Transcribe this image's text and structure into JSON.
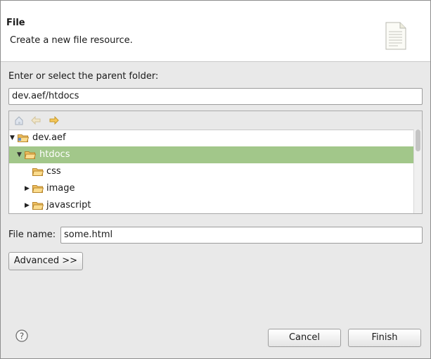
{
  "header": {
    "title": "File",
    "subtitle": "Create a new file resource."
  },
  "parent_folder": {
    "label": "Enter or select the parent folder:",
    "value": "dev.aef/htdocs"
  },
  "tree": {
    "toolbar": [
      "home-icon",
      "back-icon",
      "forward-icon"
    ],
    "items": [
      {
        "label": "dev.aef",
        "expanded": true
      },
      {
        "label": "htdocs",
        "expanded": true,
        "selected": true
      },
      {
        "label": "css"
      },
      {
        "label": "image",
        "expanded": false
      },
      {
        "label": "javascript",
        "expanded": false
      }
    ]
  },
  "file_name": {
    "label": "File name:",
    "value": "some.html"
  },
  "buttons": {
    "advanced": "Advanced >>",
    "cancel": "Cancel",
    "finish": "Finish"
  },
  "colors": {
    "selection": "#a2c78a",
    "folder": "#e8b04a"
  }
}
